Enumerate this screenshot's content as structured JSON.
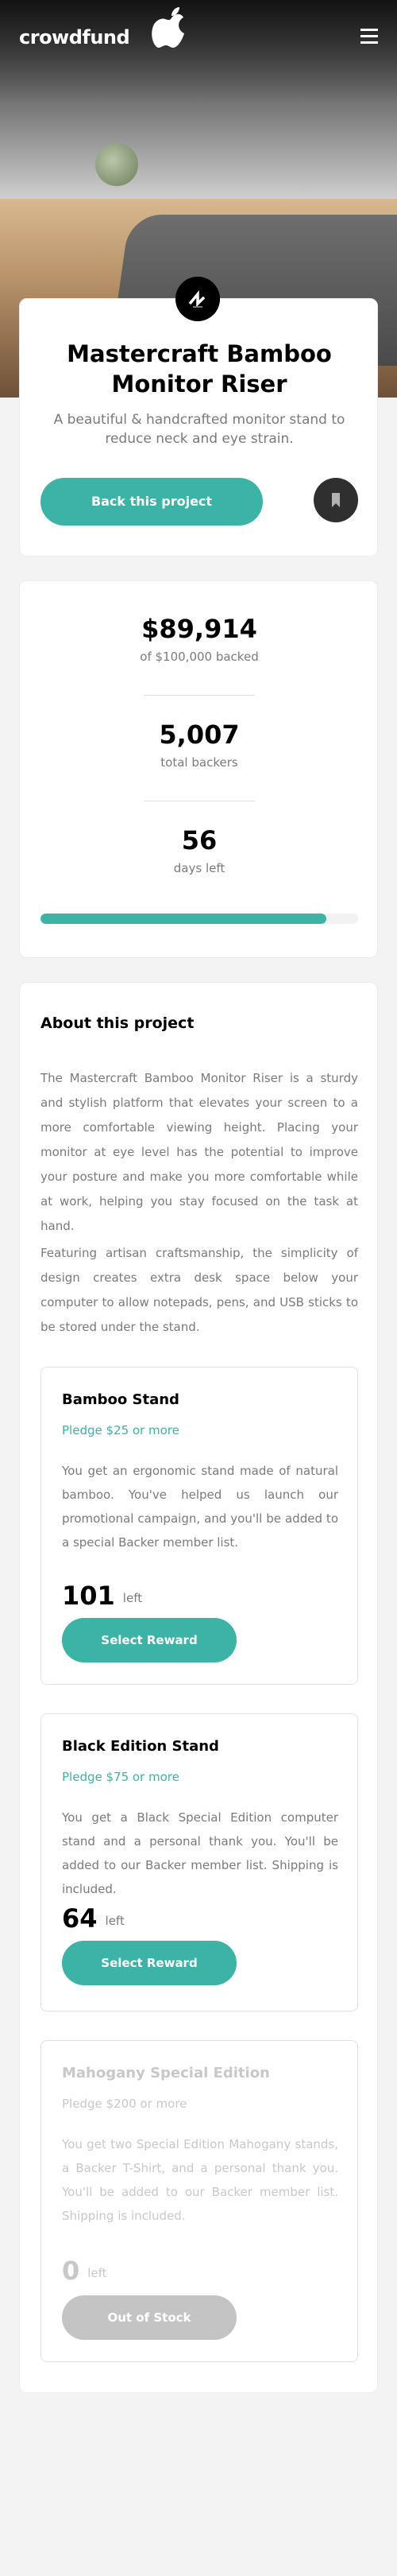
{
  "header": {
    "logo": "crowdfund",
    "menu_icon": "hamburger-icon"
  },
  "intro": {
    "logo_icon": "mastercraft-logo-icon",
    "title": "Mastercraft Bamboo Monitor Riser",
    "subtitle": "A beautiful & handcrafted monitor stand to reduce neck and eye strain.",
    "back_button": "Back this project",
    "bookmark_icon": "bookmark-icon"
  },
  "stats": {
    "backed_amount": "$89,914",
    "backed_label": "of $100,000 backed",
    "backers": "5,007",
    "backers_label": "total backers",
    "days": "56",
    "days_label": "days left",
    "progress_fraction": 0.89914
  },
  "about": {
    "title": "About this project",
    "paragraphs": [
      "The Mastercraft Bamboo Monitor Riser is a sturdy and stylish platform that elevates your screen to a more comfortable viewing height. Placing your monitor at eye level has the potential to improve your posture and make you more comfortable while at work, helping you stay focused on the task at hand.",
      "Featuring artisan craftsmanship, the simplicity of design creates extra desk space below your computer to allow notepads, pens, and USB sticks to be stored under the stand."
    ],
    "pledges": [
      {
        "name": "Bamboo Stand",
        "minimum": "Pledge $25 or more",
        "description": "You get an ergonomic stand made of natural bamboo. You've helped us launch our promotional campaign, and you'll be added to a special Backer member list.",
        "left_count": "101",
        "left_label": "left",
        "button": "Select Reward"
      },
      {
        "name": "Black Edition Stand",
        "minimum": "Pledge $75 or more",
        "description": "You get a Black Special Edition computer stand and a personal thank you. You'll be added to our Backer member list. Shipping is included.",
        "left_count": "64",
        "left_label": "left",
        "button": "Select Reward"
      },
      {
        "name": "Mahogany Special Edition",
        "minimum": "Pledge $200 or more",
        "description": "You get two Special Edition Mahogany stands, a Backer T-Shirt, and a personal thank you. You'll be added to our Backer member list. Shipping is included.",
        "left_count": "0",
        "left_label": "left",
        "button": "Out of Stock"
      }
    ]
  },
  "colors": {
    "accent": "#3cb4a5",
    "dark": "#2f2f2f",
    "muted": "#7a7a7a",
    "disabled": "#c4c4c4"
  }
}
